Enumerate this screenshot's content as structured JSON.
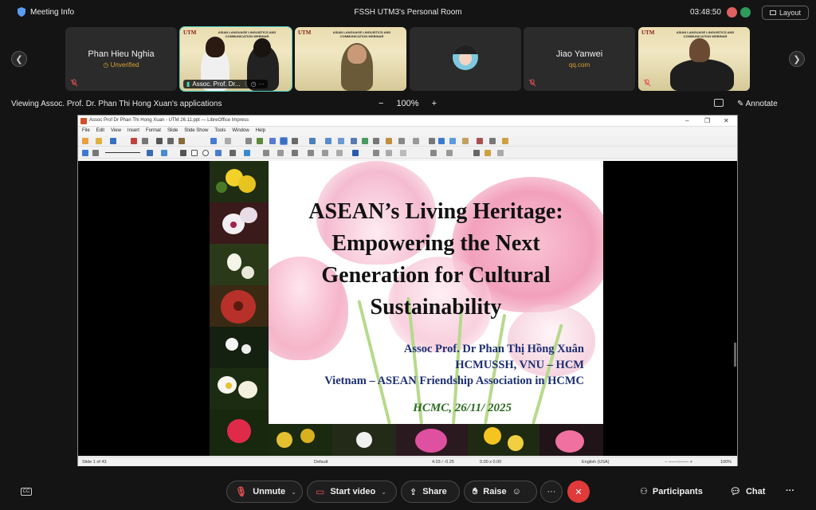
{
  "topbar": {
    "meeting_info": "Meeting Info",
    "room_title": "FSSH UTM3's Personal Room",
    "timer": "03:48:50",
    "layout_label": "Layout"
  },
  "participants": [
    {
      "name": "Phan Hieu Nghia",
      "sub": "Unverified"
    },
    {
      "name": "Assoc. Prof. Dr...",
      "utm": "UTM",
      "banner": "ASIAN LANGUAGE LINGUISTICS AND COMMUNICATION WEBINAR"
    },
    {
      "name": "",
      "utm": "UTM",
      "banner": "ASIAN LANGUAGE LINGUISTICS AND COMMUNICATION WEBINAR"
    },
    {
      "name": ""
    },
    {
      "name": "Jiao Yanwei",
      "sub": "qq.com"
    },
    {
      "name": "",
      "utm": "UTM",
      "banner": "ASIAN LANGUAGE LINGUISTICS AND COMMUNICATION WEBINAR"
    }
  ],
  "share_bar": {
    "viewing_text": "Viewing Assoc. Prof. Dr. Phan Thi Hong Xuan's applications",
    "zoom_minus": "−",
    "zoom_level": "100%",
    "zoom_plus": "+",
    "annotate_label": "Annotate"
  },
  "window": {
    "title": "Assoc Prof Dr Phan Thi Hong Xuan - UTM 26.11.ppt — LibreOffice Impress",
    "menu": [
      "File",
      "Edit",
      "View",
      "Insert",
      "Format",
      "Slide",
      "Slide Show",
      "Tools",
      "Window",
      "Help"
    ],
    "status": {
      "slide": "Slide 1 of 43",
      "layout": "Default",
      "pos": "4.03 / -0.25",
      "size": "0.00 x 0.00",
      "lang": "English (USA)",
      "zoom": "100%"
    }
  },
  "slide": {
    "title_lines": [
      "ASEAN’s Living Heritage:",
      "Empowering the Next",
      "Generation for Cultural",
      "Sustainability"
    ],
    "credit_lines": [
      "Assoc Prof. Dr Phan Thị Hồng Xuân",
      "HCMUSSH, VNU – HCM",
      "Vietnam – ASEAN Friendship Association in HCMC"
    ],
    "place": "HCMC, 26/11/ 2025"
  },
  "controls": {
    "cc": "CC",
    "unmute": "Unmute",
    "start_video": "Start video",
    "share": "Share",
    "raise": "Raise",
    "more": "···",
    "end": "✕",
    "participants": "Participants",
    "chat": "Chat",
    "overflow": "···"
  }
}
